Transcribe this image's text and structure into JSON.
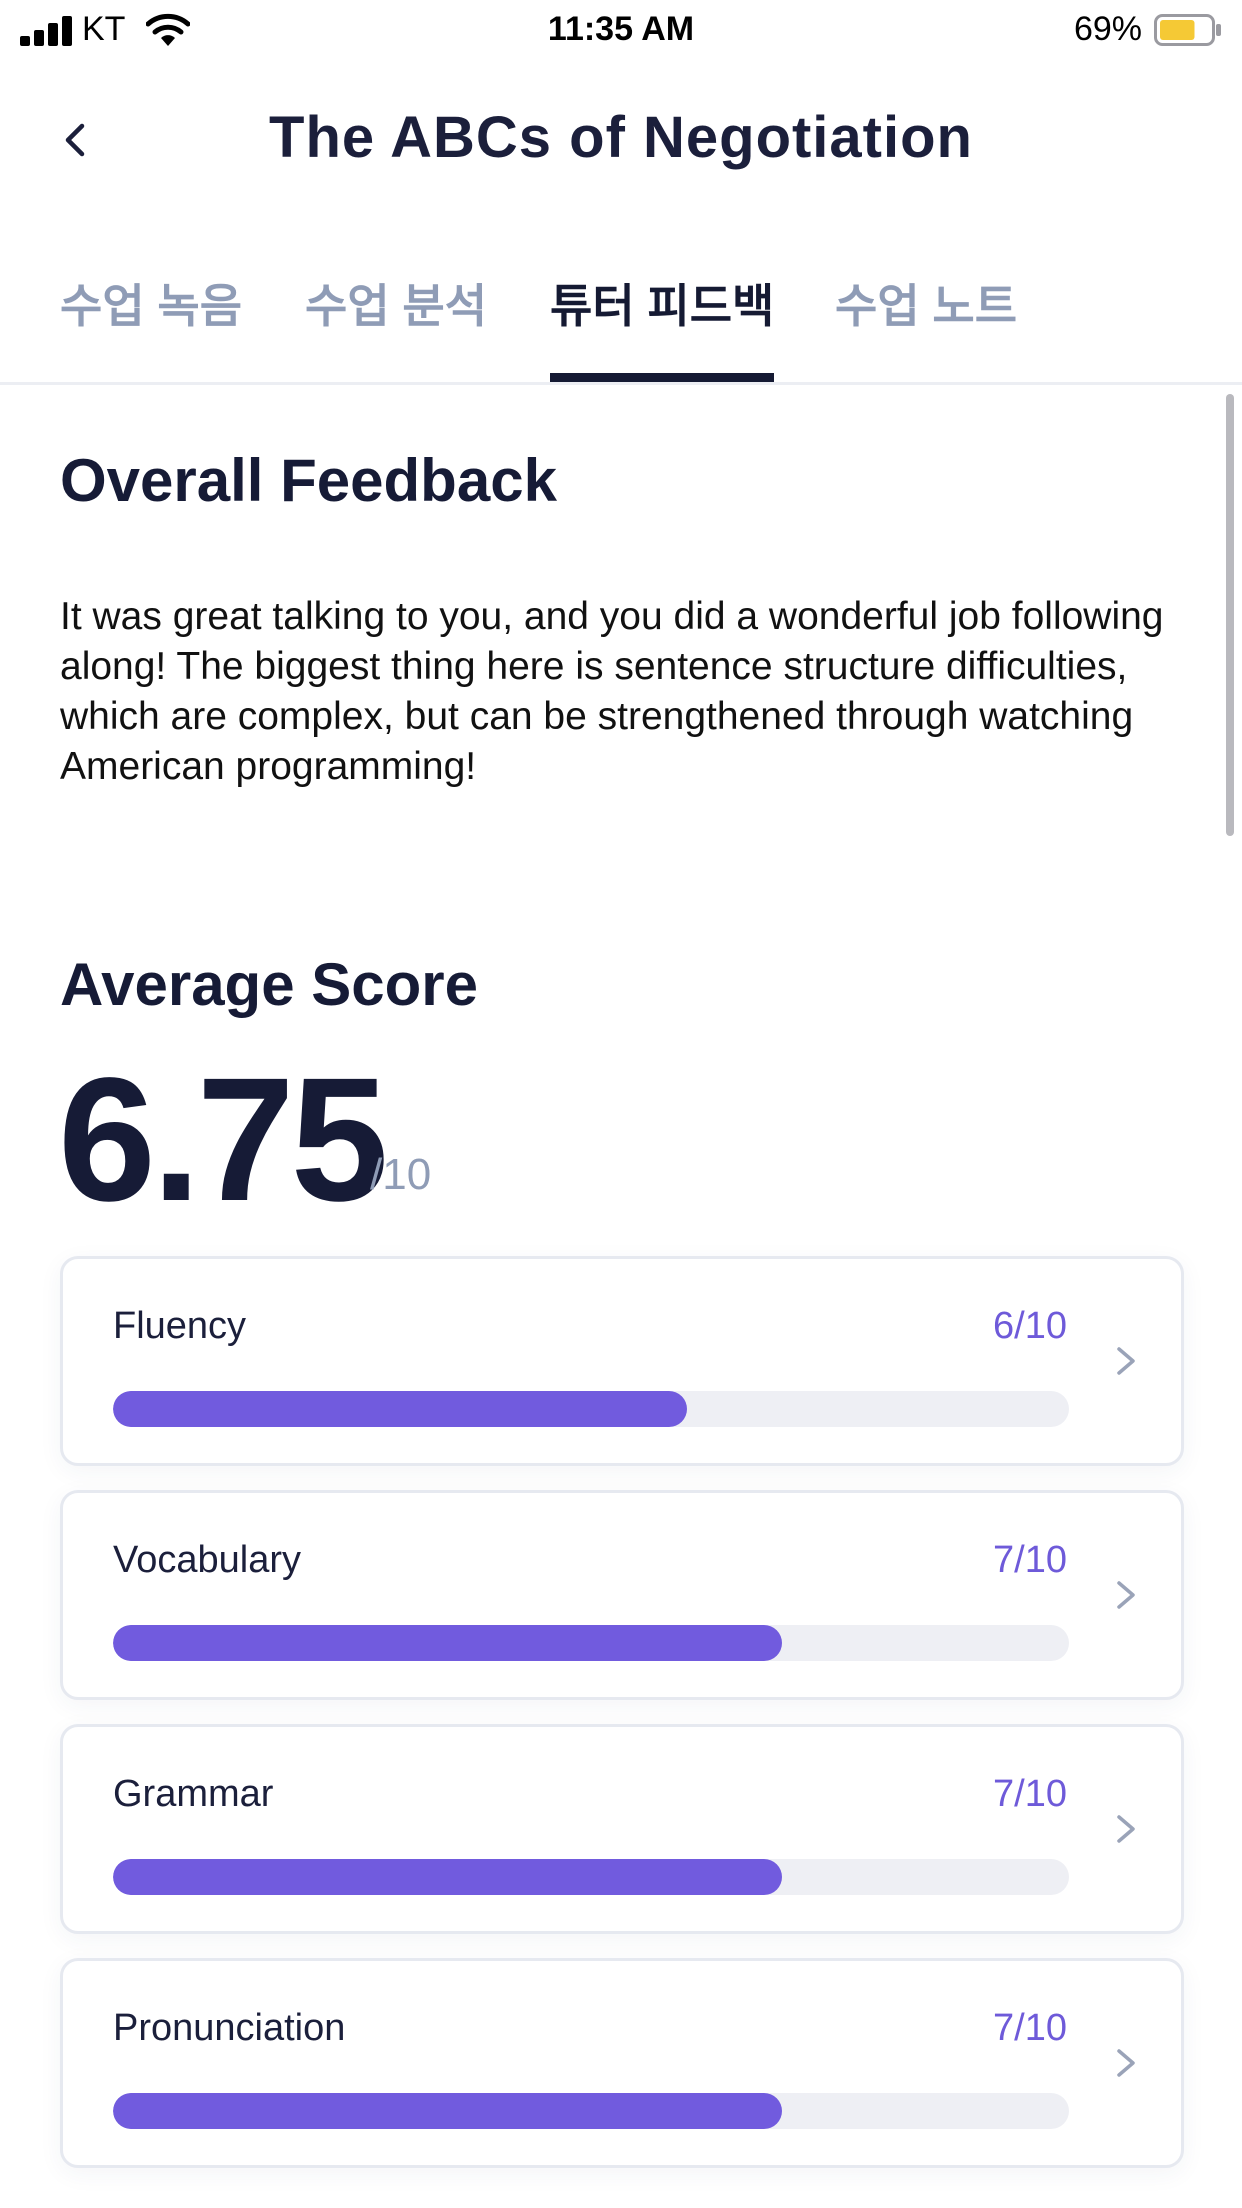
{
  "status_bar": {
    "carrier": "KT",
    "time": "11:35 AM",
    "battery_percent": "69%",
    "battery_level": 0.69,
    "battery_color": "#f5c935"
  },
  "nav": {
    "back_icon": "chevron-left-icon",
    "title": "The ABCs of Negotiation"
  },
  "tabs": [
    {
      "label": "수업 녹음",
      "active": false
    },
    {
      "label": "수업 분석",
      "active": false
    },
    {
      "label": "튜터 피드백",
      "active": true
    },
    {
      "label": "수업 노트",
      "active": false
    }
  ],
  "overall_feedback": {
    "title": "Overall Feedback",
    "text": "It was great talking to you, and you did a wonderful job following along! The biggest thing here is sentence structure difficulties, which are complex, but can be strengthened through watching American programming!"
  },
  "average_score": {
    "title": "Average Score",
    "value": "6.75",
    "max_label": "/10"
  },
  "scores": [
    {
      "label": "Fluency",
      "score_label": "6/10",
      "fraction": 0.6
    },
    {
      "label": "Vocabulary",
      "score_label": "7/10",
      "fraction": 0.7
    },
    {
      "label": "Grammar",
      "score_label": "7/10",
      "fraction": 0.7
    },
    {
      "label": "Pronunciation",
      "score_label": "7/10",
      "fraction": 0.7
    }
  ],
  "colors": {
    "accent": "#715bde",
    "title_dark": "#161b36",
    "muted": "#8f9cb6"
  }
}
